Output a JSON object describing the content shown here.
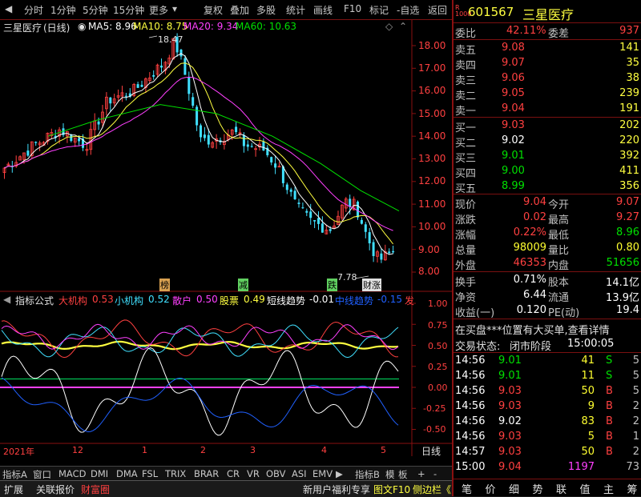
{
  "toolbar": {
    "items": [
      "分时",
      "1分钟",
      "5分钟",
      "15分钟",
      "更多",
      "复权",
      "叠加",
      "多股",
      "统计",
      "画线",
      "F10",
      "标记",
      "-自选",
      "返回"
    ]
  },
  "chart": {
    "stock_name": "三星医疗",
    "period": "(日线)",
    "ma5": "MA5: 8.96",
    "ma10": "MA10: 8.75",
    "ma20": "MA20: 9.34",
    "ma60": "MA60: 10.63",
    "high_marker": "18.47",
    "low_marker": "7.78",
    "y_labels": [
      "18.00",
      "17.00",
      "16.00",
      "15.00",
      "14.00",
      "13.00",
      "12.00",
      "11.00",
      "10.00",
      "9.00",
      "8.00"
    ],
    "tags": [
      "榜",
      "减",
      "跌",
      "财涨"
    ],
    "x_labels": [
      "2021年",
      "12",
      "1",
      "2",
      "3",
      "4",
      "5"
    ],
    "colors": {
      "ma5": "#ffffff",
      "ma10": "#ffff40",
      "ma20": "#ff40ff",
      "ma60": "#00e000",
      "up": "#ff4040",
      "down": "#40e0ff"
    }
  },
  "indicator": {
    "name": "指标公式",
    "labels": [
      {
        "k": "大机构",
        "v": "0.53",
        "c": "#ff4040"
      },
      {
        "k": "小机构",
        "v": "0.52",
        "c": "#40e0ff"
      },
      {
        "k": "散户",
        "v": "0.50",
        "c": "#ff40ff"
      },
      {
        "k": "股票",
        "v": "0.49",
        "c": "#ffff40"
      },
      {
        "k": "短线趋势",
        "v": "-0.01",
        "c": "#ffffff"
      },
      {
        "k": "中线趋势",
        "v": "-0.15",
        "c": "#2060ff"
      }
    ],
    "extra": "发",
    "y_labels": [
      "1.00",
      "0.75",
      "0.50",
      "0.25",
      "0.00",
      "-0.25",
      "-0.50"
    ],
    "right_label": "日线"
  },
  "tabs": [
    "指标A",
    "窗口",
    "MACD",
    "DMI",
    "DMA",
    "FSL",
    "TRIX",
    "BRAR",
    "CR",
    "VR",
    "OBV",
    "ASI",
    "EMV",
    "指标B",
    "模",
    "板",
    "+",
    "-"
  ],
  "status": {
    "items": [
      "扩展",
      "关联报价",
      "财富圈"
    ],
    "promo": "新用户福利专享",
    "right": [
      "图文F10",
      "侧边栏《"
    ]
  },
  "quote": {
    "code": "601567",
    "name": "三星医疗",
    "wb_label": "委比",
    "wb": "42.11%",
    "wc_label": "委差",
    "wc": "937",
    "asks": [
      {
        "label": "卖五",
        "price": "9.08",
        "vol": "141"
      },
      {
        "label": "卖四",
        "price": "9.07",
        "vol": "35"
      },
      {
        "label": "卖三",
        "price": "9.06",
        "vol": "38"
      },
      {
        "label": "卖二",
        "price": "9.05",
        "vol": "239"
      },
      {
        "label": "卖一",
        "price": "9.04",
        "vol": "191"
      }
    ],
    "bids": [
      {
        "label": "买一",
        "price": "9.03",
        "vol": "202",
        "pc": "red"
      },
      {
        "label": "买二",
        "price": "9.02",
        "vol": "220",
        "pc": "white"
      },
      {
        "label": "买三",
        "price": "9.01",
        "vol": "392",
        "pc": "green"
      },
      {
        "label": "买四",
        "price": "9.00",
        "vol": "411",
        "pc": "green"
      },
      {
        "label": "买五",
        "price": "8.99",
        "vol": "356",
        "pc": "green"
      }
    ],
    "stats": [
      {
        "l1": "现价",
        "v1": "9.04",
        "c1": "red",
        "l2": "今开",
        "v2": "9.07",
        "c2": "red"
      },
      {
        "l1": "涨跌",
        "v1": "0.02",
        "c1": "red",
        "l2": "最高",
        "v2": "9.27",
        "c2": "red"
      },
      {
        "l1": "涨幅",
        "v1": "0.22%",
        "c1": "red",
        "l2": "最低",
        "v2": "8.96",
        "c2": "green"
      },
      {
        "l1": "总量",
        "v1": "98009",
        "c1": "yellow",
        "l2": "量比",
        "v2": "0.80",
        "c2": "yellow"
      },
      {
        "l1": "外盘",
        "v1": "46353",
        "c1": "red",
        "l2": "内盘",
        "v2": "51656",
        "c2": "green"
      }
    ],
    "stats2": [
      {
        "l1": "换手",
        "v1": "0.71%",
        "l2": "股本",
        "v2": "14.1亿"
      },
      {
        "l1": "净资",
        "v1": "6.44",
        "l2": "流通",
        "v2": "13.9亿"
      },
      {
        "l1": "收益(一)",
        "v1": "0.120",
        "l2": "PE(动)",
        "v2": "19.4"
      }
    ],
    "notice": "在买盘***位置有大买单,查看详情",
    "trade_state_label": "交易状态:",
    "trade_state": "闭市阶段",
    "trade_time": "15:00:05",
    "ticks": [
      {
        "t": "14:56",
        "p": "9.01",
        "pc": "green",
        "v": "41",
        "vc": "yellow",
        "d": "S",
        "dc": "green",
        "n": "5"
      },
      {
        "t": "14:56",
        "p": "9.01",
        "pc": "green",
        "v": "11",
        "vc": "yellow",
        "d": "S",
        "dc": "green",
        "n": "5"
      },
      {
        "t": "14:56",
        "p": "9.03",
        "pc": "red",
        "v": "50",
        "vc": "yellow",
        "d": "B",
        "dc": "red",
        "n": "5"
      },
      {
        "t": "14:56",
        "p": "9.03",
        "pc": "red",
        "v": "9",
        "vc": "yellow",
        "d": "B",
        "dc": "red",
        "n": "2"
      },
      {
        "t": "14:56",
        "p": "9.02",
        "pc": "white",
        "v": "83",
        "vc": "yellow",
        "d": "B",
        "dc": "red",
        "n": "2"
      },
      {
        "t": "14:56",
        "p": "9.03",
        "pc": "red",
        "v": "5",
        "vc": "yellow",
        "d": "B",
        "dc": "red",
        "n": "1"
      },
      {
        "t": "14:57",
        "p": "9.03",
        "pc": "red",
        "v": "50",
        "vc": "yellow",
        "d": "B",
        "dc": "red",
        "n": "2"
      },
      {
        "t": "15:00",
        "p": "9.04",
        "pc": "red",
        "v": "1197",
        "vc": "magenta",
        "d": "",
        "dc": "red",
        "n": "73"
      }
    ],
    "bottom_tabs": [
      "笔",
      "价",
      "细",
      "势",
      "联",
      "值",
      "主",
      "筹"
    ]
  }
}
